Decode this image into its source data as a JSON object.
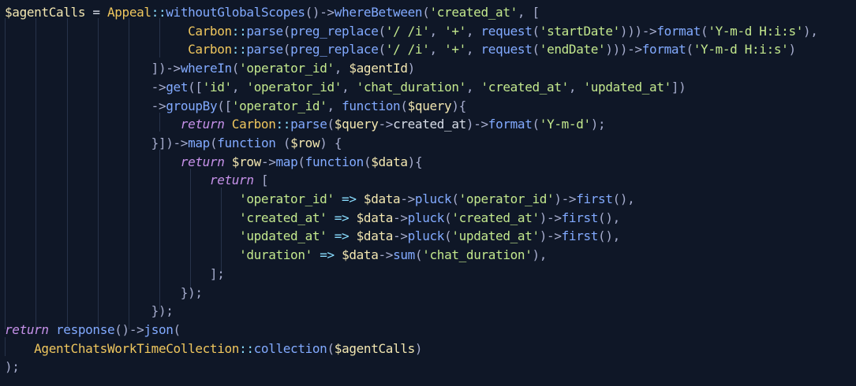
{
  "editor": {
    "colors": {
      "background": "#0f1727",
      "variable": "#f3e7b1",
      "class": "#f0c75e",
      "function": "#82aaff",
      "string": "#c3e88d",
      "keyword": "#c792ea",
      "plain": "#d8dee9",
      "operator": "#89ddff"
    },
    "lines": [
      [
        [
          "var",
          "$agentCalls"
        ],
        [
          "plain",
          " = "
        ],
        [
          "class",
          "Appeal"
        ],
        [
          "op",
          "::"
        ],
        [
          "fn",
          "withoutGlobalScopes"
        ],
        [
          "punct",
          "()->"
        ],
        [
          "fn",
          "whereBetween"
        ],
        [
          "punct",
          "("
        ],
        [
          "str",
          "'created_at'"
        ],
        [
          "punct",
          ", ["
        ]
      ],
      [
        [
          "plain",
          "                         "
        ],
        [
          "class",
          "Carbon"
        ],
        [
          "op",
          "::"
        ],
        [
          "fn",
          "parse"
        ],
        [
          "punct",
          "("
        ],
        [
          "fn",
          "preg_replace"
        ],
        [
          "punct",
          "("
        ],
        [
          "str",
          "'/ /i'"
        ],
        [
          "punct",
          ", "
        ],
        [
          "str",
          "'+'"
        ],
        [
          "punct",
          ", "
        ],
        [
          "fn",
          "request"
        ],
        [
          "punct",
          "("
        ],
        [
          "str",
          "'startDate'"
        ],
        [
          "punct",
          ")))->"
        ],
        [
          "fn",
          "format"
        ],
        [
          "punct",
          "("
        ],
        [
          "str",
          "'Y-m-d H:i:s'"
        ],
        [
          "punct",
          "),"
        ]
      ],
      [
        [
          "plain",
          "                         "
        ],
        [
          "class",
          "Carbon"
        ],
        [
          "op",
          "::"
        ],
        [
          "fn",
          "parse"
        ],
        [
          "punct",
          "("
        ],
        [
          "fn",
          "preg_replace"
        ],
        [
          "punct",
          "("
        ],
        [
          "str",
          "'/ /i'"
        ],
        [
          "punct",
          ", "
        ],
        [
          "str",
          "'+'"
        ],
        [
          "punct",
          ", "
        ],
        [
          "fn",
          "request"
        ],
        [
          "punct",
          "("
        ],
        [
          "str",
          "'endDate'"
        ],
        [
          "punct",
          ")))->"
        ],
        [
          "fn",
          "format"
        ],
        [
          "punct",
          "("
        ],
        [
          "str",
          "'Y-m-d H:i:s'"
        ],
        [
          "punct",
          ")"
        ]
      ],
      [
        [
          "plain",
          "                    "
        ],
        [
          "punct",
          "])->"
        ],
        [
          "fn",
          "whereIn"
        ],
        [
          "punct",
          "("
        ],
        [
          "str",
          "'operator_id'"
        ],
        [
          "punct",
          ", "
        ],
        [
          "var",
          "$agentId"
        ],
        [
          "punct",
          ")"
        ]
      ],
      [
        [
          "plain",
          "                    "
        ],
        [
          "punct",
          "->"
        ],
        [
          "fn",
          "get"
        ],
        [
          "punct",
          "(["
        ],
        [
          "str",
          "'id'"
        ],
        [
          "punct",
          ", "
        ],
        [
          "str",
          "'operator_id'"
        ],
        [
          "punct",
          ", "
        ],
        [
          "str",
          "'chat_duration'"
        ],
        [
          "punct",
          ", "
        ],
        [
          "str",
          "'created_at'"
        ],
        [
          "punct",
          ", "
        ],
        [
          "str",
          "'updated_at'"
        ],
        [
          "punct",
          "])"
        ]
      ],
      [
        [
          "plain",
          "                    "
        ],
        [
          "punct",
          "->"
        ],
        [
          "fn",
          "groupBy"
        ],
        [
          "punct",
          "(["
        ],
        [
          "str",
          "'operator_id'"
        ],
        [
          "punct",
          ", "
        ],
        [
          "fn",
          "function"
        ],
        [
          "punct",
          "("
        ],
        [
          "var",
          "$query"
        ],
        [
          "punct",
          "){"
        ]
      ],
      [
        [
          "plain",
          "                        "
        ],
        [
          "kw",
          "return"
        ],
        [
          "plain",
          " "
        ],
        [
          "class",
          "Carbon"
        ],
        [
          "op",
          "::"
        ],
        [
          "fn",
          "parse"
        ],
        [
          "punct",
          "("
        ],
        [
          "var",
          "$query"
        ],
        [
          "punct",
          "->"
        ],
        [
          "plain",
          "created_at"
        ],
        [
          "punct",
          ")->"
        ],
        [
          "fn",
          "format"
        ],
        [
          "punct",
          "("
        ],
        [
          "str",
          "'Y-m-d'"
        ],
        [
          "punct",
          ");"
        ]
      ],
      [
        [
          "plain",
          "                    "
        ],
        [
          "punct",
          "}])->"
        ],
        [
          "fn",
          "map"
        ],
        [
          "punct",
          "("
        ],
        [
          "fn",
          "function"
        ],
        [
          "plain",
          " "
        ],
        [
          "punct",
          "("
        ],
        [
          "var",
          "$row"
        ],
        [
          "punct",
          ") {"
        ]
      ],
      [
        [
          "plain",
          "                        "
        ],
        [
          "kw",
          "return"
        ],
        [
          "plain",
          " "
        ],
        [
          "var",
          "$row"
        ],
        [
          "punct",
          "->"
        ],
        [
          "fn",
          "map"
        ],
        [
          "punct",
          "("
        ],
        [
          "fn",
          "function"
        ],
        [
          "punct",
          "("
        ],
        [
          "var",
          "$data"
        ],
        [
          "punct",
          "){"
        ]
      ],
      [
        [
          "plain",
          "                            "
        ],
        [
          "kw",
          "return"
        ],
        [
          "plain",
          " "
        ],
        [
          "punct",
          "["
        ]
      ],
      [
        [
          "plain",
          "                                "
        ],
        [
          "str",
          "'operator_id'"
        ],
        [
          "plain",
          " "
        ],
        [
          "op",
          "=>"
        ],
        [
          "plain",
          " "
        ],
        [
          "var",
          "$data"
        ],
        [
          "punct",
          "->"
        ],
        [
          "fn",
          "pluck"
        ],
        [
          "punct",
          "("
        ],
        [
          "str",
          "'operator_id'"
        ],
        [
          "punct",
          ")->"
        ],
        [
          "fn",
          "first"
        ],
        [
          "punct",
          "(),"
        ]
      ],
      [
        [
          "plain",
          "                                "
        ],
        [
          "str",
          "'created_at'"
        ],
        [
          "plain",
          " "
        ],
        [
          "op",
          "=>"
        ],
        [
          "plain",
          " "
        ],
        [
          "var",
          "$data"
        ],
        [
          "punct",
          "->"
        ],
        [
          "fn",
          "pluck"
        ],
        [
          "punct",
          "("
        ],
        [
          "str",
          "'created_at'"
        ],
        [
          "punct",
          ")->"
        ],
        [
          "fn",
          "first"
        ],
        [
          "punct",
          "(),"
        ]
      ],
      [
        [
          "plain",
          "                                "
        ],
        [
          "str",
          "'updated_at'"
        ],
        [
          "plain",
          " "
        ],
        [
          "op",
          "=>"
        ],
        [
          "plain",
          " "
        ],
        [
          "var",
          "$data"
        ],
        [
          "punct",
          "->"
        ],
        [
          "fn",
          "pluck"
        ],
        [
          "punct",
          "("
        ],
        [
          "str",
          "'updated_at'"
        ],
        [
          "punct",
          ")->"
        ],
        [
          "fn",
          "first"
        ],
        [
          "punct",
          "(),"
        ]
      ],
      [
        [
          "plain",
          "                                "
        ],
        [
          "str",
          "'duration'"
        ],
        [
          "plain",
          " "
        ],
        [
          "op",
          "=>"
        ],
        [
          "plain",
          " "
        ],
        [
          "var",
          "$data"
        ],
        [
          "punct",
          "->"
        ],
        [
          "fn",
          "sum"
        ],
        [
          "punct",
          "("
        ],
        [
          "str",
          "'chat_duration'"
        ],
        [
          "punct",
          "),"
        ]
      ],
      [
        [
          "plain",
          "                            "
        ],
        [
          "punct",
          "];"
        ]
      ],
      [
        [
          "plain",
          "                        "
        ],
        [
          "punct",
          "});"
        ]
      ],
      [
        [
          "plain",
          "                    "
        ],
        [
          "punct",
          "});"
        ]
      ],
      [
        [
          "kw",
          "return"
        ],
        [
          "plain",
          " "
        ],
        [
          "fn",
          "response"
        ],
        [
          "punct",
          "()->"
        ],
        [
          "fn",
          "json"
        ],
        [
          "punct",
          "("
        ]
      ],
      [
        [
          "plain",
          "    "
        ],
        [
          "class",
          "AgentChatsWorkTimeCollection"
        ],
        [
          "op",
          "::"
        ],
        [
          "fn",
          "collection"
        ],
        [
          "punct",
          "("
        ],
        [
          "var",
          "$agentCalls"
        ],
        [
          "punct",
          ")"
        ]
      ],
      [
        [
          "punct",
          ");"
        ]
      ]
    ]
  }
}
